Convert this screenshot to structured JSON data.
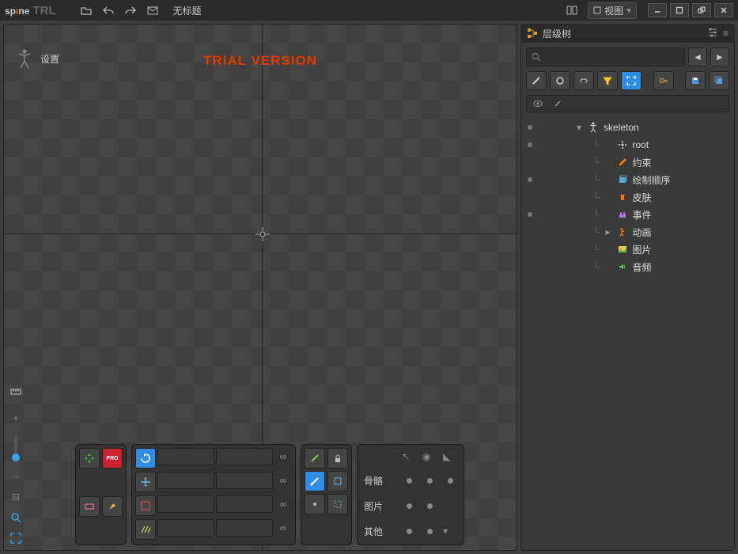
{
  "titlebar": {
    "logo_part1": "sp",
    "logo_part2": "ι",
    "logo_part3": "ne",
    "trial_tag": "TRL",
    "document_title": "无标题",
    "view_button": "视图"
  },
  "viewport": {
    "mode_label": "设置",
    "watermark": "TRIAL VERSION"
  },
  "vis_panel": {
    "row1": "骨骼",
    "row2": "图片",
    "row3": "其他"
  },
  "hierarchy": {
    "title": "层级树",
    "search_placeholder": "",
    "items": [
      {
        "label": "skeleton",
        "icon": "man",
        "depth": 0,
        "expand": "v",
        "dot": true
      },
      {
        "label": "root",
        "icon": "root",
        "depth": 1,
        "expand": "",
        "dot": true
      },
      {
        "label": "约束",
        "icon": "con",
        "depth": 1,
        "expand": "",
        "dot": false
      },
      {
        "label": "绘制顺序",
        "icon": "order",
        "depth": 1,
        "expand": "",
        "dot": true
      },
      {
        "label": "皮肤",
        "icon": "skin",
        "depth": 1,
        "expand": "",
        "dot": false
      },
      {
        "label": "事件",
        "icon": "event",
        "depth": 1,
        "expand": "",
        "dot": true
      },
      {
        "label": "动画",
        "icon": "anim",
        "depth": 1,
        "expand": ">",
        "dot": false
      },
      {
        "label": "图片",
        "icon": "img",
        "depth": 1,
        "expand": "",
        "dot": false
      },
      {
        "label": "音频",
        "icon": "audio",
        "depth": 1,
        "expand": "",
        "dot": false
      }
    ]
  }
}
